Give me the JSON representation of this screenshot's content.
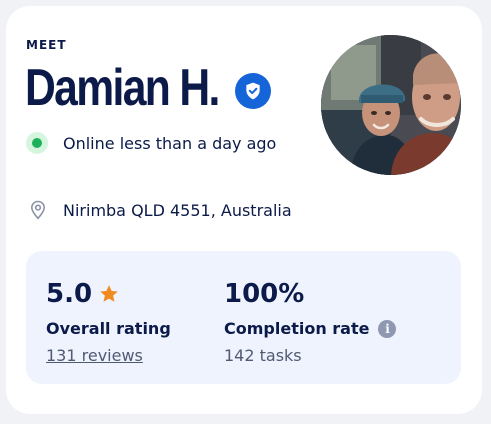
{
  "profile": {
    "eyebrow": "MEET",
    "name": "Damian H.",
    "verified_icon": "verified-shield-icon",
    "status_text": "Online less than a day ago",
    "status_color": "#1fb15a",
    "location_icon": "map-pin-icon",
    "location_text": "Nirimba QLD 4551, Australia"
  },
  "stats": {
    "rating": {
      "value": "5.0",
      "icon": "star-icon",
      "star_color": "#f08b1d",
      "label": "Overall rating",
      "reviews_link": "131 reviews"
    },
    "completion": {
      "value": "100%",
      "label": "Completion rate",
      "info_icon": "info-icon",
      "info_glyph": "i",
      "tasks": "142 tasks"
    }
  },
  "colors": {
    "brand_navy": "#0b1a48",
    "verified_blue": "#1564d8",
    "stats_bg": "#eef3fd"
  }
}
